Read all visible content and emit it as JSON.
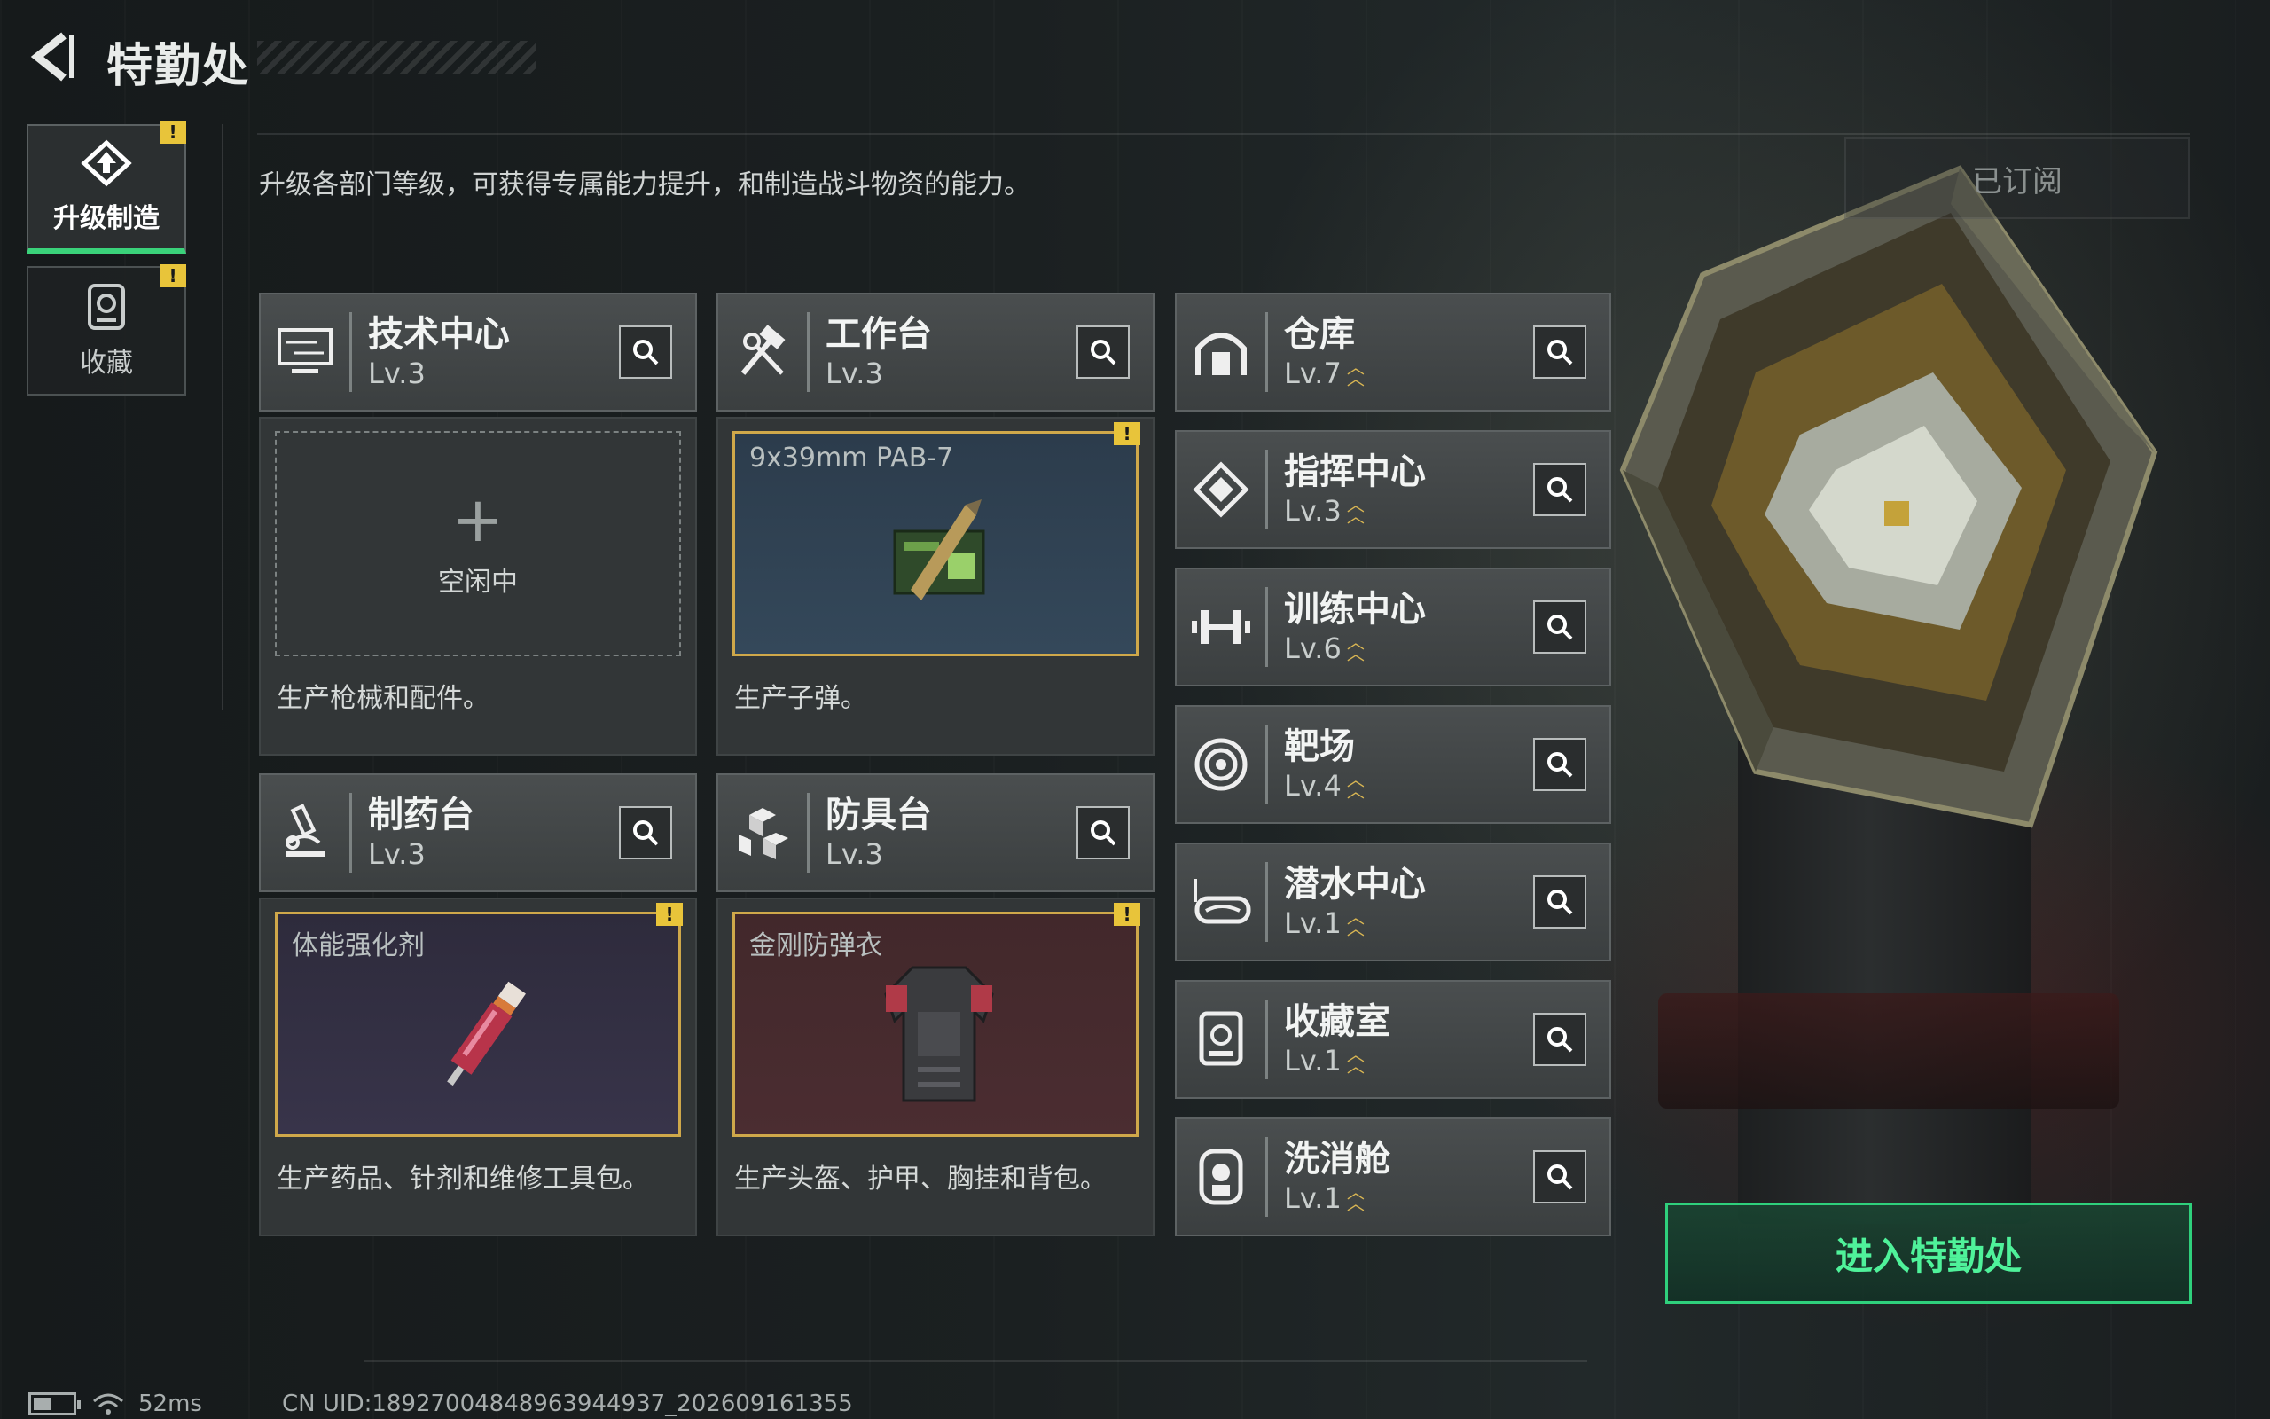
{
  "header": {
    "title": "特勤处"
  },
  "sidebar": {
    "items": [
      {
        "label": "升级制造",
        "icon": "upgrade-icon",
        "active": true,
        "alert": "!"
      },
      {
        "label": "收藏",
        "icon": "collection-icon",
        "active": false,
        "alert": "!"
      }
    ]
  },
  "main": {
    "description": "升级各部门等级，可获得专属能力提升，和制造战斗物资的能力。",
    "subscribed_label": "已订阅",
    "production": [
      {
        "name": "技术中心",
        "level": "Lv.3",
        "icon": "monitor-icon",
        "slot_state": "idle",
        "slot_text": "空闲中",
        "item": "",
        "desc": "生产枪械和配件。"
      },
      {
        "name": "工作台",
        "level": "Lv.3",
        "icon": "tools-icon",
        "slot_state": "item",
        "item": "9x39mm PAB-7",
        "alert": "!",
        "desc": "生产子弹。"
      },
      {
        "name": "制药台",
        "level": "Lv.3",
        "icon": "microscope-icon",
        "slot_state": "item",
        "item": "体能强化剂",
        "alert": "!",
        "desc": "生产药品、针剂和维修工具包。"
      },
      {
        "name": "防具台",
        "level": "Lv.3",
        "icon": "armor-icon",
        "slot_state": "item",
        "item": "金刚防弹衣",
        "alert": "!",
        "desc": "生产头盔、护甲、胸挂和背包。"
      }
    ],
    "facilities": [
      {
        "name": "仓库",
        "level": "Lv.7",
        "icon": "warehouse-icon"
      },
      {
        "name": "指挥中心",
        "level": "Lv.3",
        "icon": "command-icon"
      },
      {
        "name": "训练中心",
        "level": "Lv.6",
        "icon": "dumbbell-icon"
      },
      {
        "name": "靶场",
        "level": "Lv.4",
        "icon": "target-icon"
      },
      {
        "name": "潜水中心",
        "level": "Lv.1",
        "icon": "goggles-icon"
      },
      {
        "name": "收藏室",
        "level": "Lv.1",
        "icon": "collection-room-icon"
      },
      {
        "name": "洗消舱",
        "level": "Lv.1",
        "icon": "decon-icon"
      }
    ],
    "enter_button": "进入特勤处"
  },
  "footer": {
    "ping": "52ms",
    "uid": "CN UID:18927004848963944937_202609161355"
  },
  "colors": {
    "accent_green": "#2fd07c",
    "alert_yellow": "#e8c43a",
    "item_border": "#cfa84a"
  }
}
